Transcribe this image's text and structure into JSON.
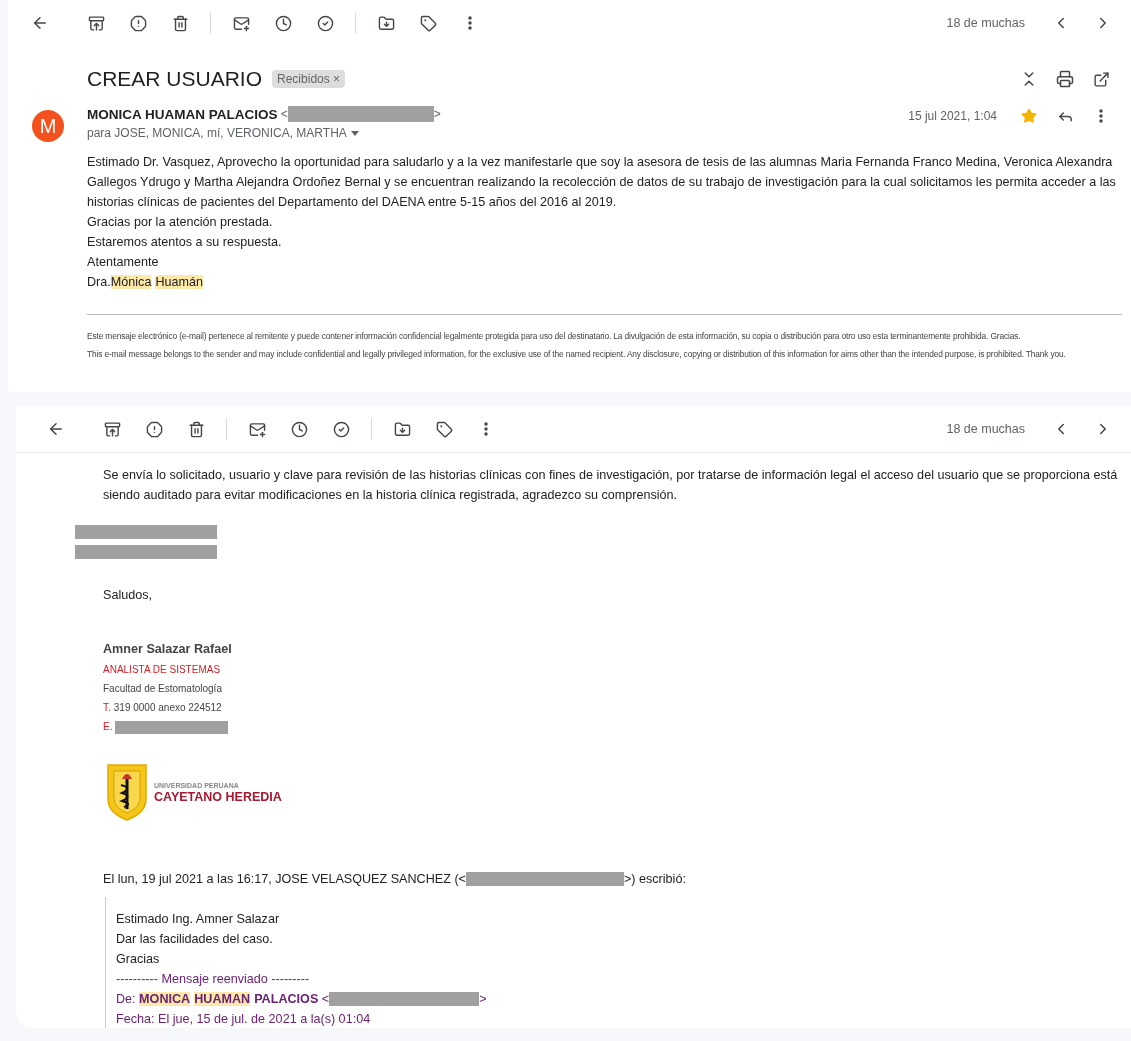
{
  "first_view": {
    "counter": "18 de muchas",
    "subject": "CREAR USUARIO",
    "label_chip": {
      "text": "Recibidos",
      "close": "×"
    },
    "sender": {
      "avatar_letter": "M",
      "name": "MONICA HUAMAN PALACIOS",
      "open_bracket": "<",
      "close_bracket": ">",
      "recipients": "para JOSE, MONICA, mí, VERONICA, MARTHA",
      "date": "15 jul 2021, 1:04",
      "starred": true
    },
    "body": [
      "Estimado Dr. Vasquez, Aprovecho la oportunidad para saludarlo y a la vez manifestarle que soy la asesora de tesis de las alumnas Maria Fernanda Franco Medina, Veronica Alexandra Gallegos Ydrugo y Martha Alejandra Ordoñez Bernal y se encuentran realizando la recolección de datos de su trabajo de investigación para la cual solicitamos les permita acceder a las historias clínicas de pacientes del Departamento del DAENA entre 5-15 años del 2016 al 2019.",
      "Gracias por la atención prestada.",
      "Estaremos atentos a su respuesta.",
      "Atentamente"
    ],
    "signature": {
      "prefix": "Dra.",
      "names": [
        {
          "text": "Mónica",
          "highlighted": true
        },
        {
          "text": "Huamán",
          "highlighted": true
        }
      ]
    },
    "disclaimer": [
      "Este mensaje electrónico (e-mail) pertenece al remitente y puede contener  información confidencial legalmente protegida para uso del destinatario. La divulgación de esta información, su copia o distribución para otro uso esta terminantemente prohibida. Gracias.",
      "This e-mail message belongs to the sender and may include confidential and legally privileged information, for the exclusive use of the named recipient. Any disclosure, copying or distribution of this information for aims other than the intended purpose, is prohibited. Thank you."
    ]
  },
  "second_view": {
    "counter": "18 de muchas",
    "body": "Se envía lo solicitado, usuario y clave para revisión de las historias clínicas con fines de investigación, por tratarse de información legal el acceso del usuario que se proporciona está siendo auditado para evitar modificaciones en la historia clínica registrada, agradezco su comprensión.",
    "greeting": "Saludos,",
    "signature": {
      "name": "Amner Salazar Rafael",
      "title": "ANALISTA DE SISTEMAS",
      "faculty": "Facultad de Estomatología",
      "phone_prefix": "T.",
      "phone": "319 0000 anexo 224512",
      "email_prefix": "E."
    },
    "logo": {
      "line_1": "UNIVERSIDAD PERUANA",
      "line_2": "CAYETANO HEREDIA"
    },
    "quote_header": {
      "before": "El lun, 19 jul 2021 a las 16:17, JOSE VELASQUEZ SANCHEZ (<",
      "after": ">) escribió:"
    },
    "quote": {
      "lines": [
        "Estimado Ing. Amner Salazar",
        "Dar las facilidades del caso.",
        "Gracias"
      ],
      "forwarded_marker": "---------- Mensaje reenviado ---------",
      "from_label": "De:",
      "from_parts": [
        {
          "text": "MONICA",
          "highlighted": true
        },
        {
          "text": "HUAMAN",
          "highlighted": true
        },
        {
          "text": "PALACIOS",
          "highlighted": false
        }
      ],
      "open_bracket": "<",
      "close_bracket": ">",
      "date_line": "Fecha: El jue, 15 de jul. de 2021 a la(s) 01:04"
    }
  }
}
